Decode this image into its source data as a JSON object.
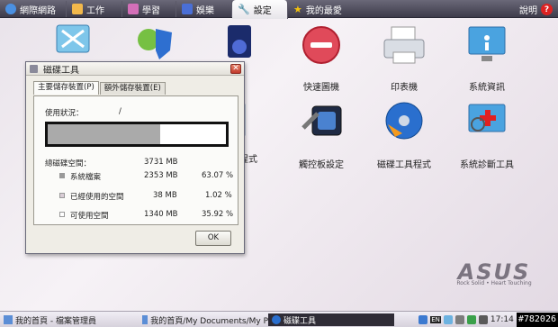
{
  "tabs": [
    {
      "label": "網際網路",
      "icon": "globe-icon",
      "color": "#4a90e2",
      "active": false
    },
    {
      "label": "工作",
      "icon": "folder-icon",
      "color": "#f2b84b",
      "active": false
    },
    {
      "label": "學習",
      "icon": "book-icon",
      "color": "#d36fb8",
      "active": false
    },
    {
      "label": "娛樂",
      "icon": "media-icon",
      "color": "#4a6fd6",
      "active": false
    },
    {
      "label": "設定",
      "icon": "wrench-icon",
      "color": "#555555",
      "active": true
    },
    {
      "label": "我的最愛",
      "icon": "star-icon",
      "color": "#f4c20d",
      "active": false
    }
  ],
  "help": {
    "label": "說明",
    "icon": "help-icon"
  },
  "desktop_icons": [
    {
      "label": "快速圖機"
    },
    {
      "label": "印表機"
    },
    {
      "label": "系統資訊"
    },
    {
      "label": "程式"
    },
    {
      "label": "觸控板設定"
    },
    {
      "label": "磁碟工具程式"
    },
    {
      "label": "系統診斷工具"
    }
  ],
  "brand": {
    "logo": "ASUS",
    "tagline": "Rock Solid • Heart Touching"
  },
  "dialog": {
    "title": "磁碟工具",
    "close_label": "✕",
    "tabs": [
      "主要儲存裝置(P)",
      "額外儲存裝置(E)"
    ],
    "usage_label": "使用狀況：",
    "usage_path": "/",
    "used_fraction": 0.6307,
    "total_label": "總磁碟空間：",
    "total_value": "3731 MB",
    "rows": [
      {
        "label": "系統檔案",
        "value": "2353 MB",
        "percent": "63.07 %",
        "swatch": "#9a9a9a"
      },
      {
        "label": "已經使用的空間",
        "value": "38 MB",
        "percent": "1.02 %",
        "swatch": "#d9cdd6"
      },
      {
        "label": "可使用空間",
        "value": "1340 MB",
        "percent": "35.92 %",
        "swatch": "#ffffff"
      }
    ],
    "ok_label": "OK"
  },
  "taskbar": {
    "items": [
      {
        "label": "我的首頁 - 檔案管理員",
        "icon": "folder-icon",
        "active": false
      },
      {
        "label": "我的首頁/My Documents/My P",
        "icon": "folder-icon",
        "active": false
      },
      {
        "label": "磁碟工具",
        "icon": "disk-icon",
        "active": true
      }
    ],
    "tray": {
      "time": "17:14",
      "lang": "EN",
      "counter": "#782026"
    }
  }
}
